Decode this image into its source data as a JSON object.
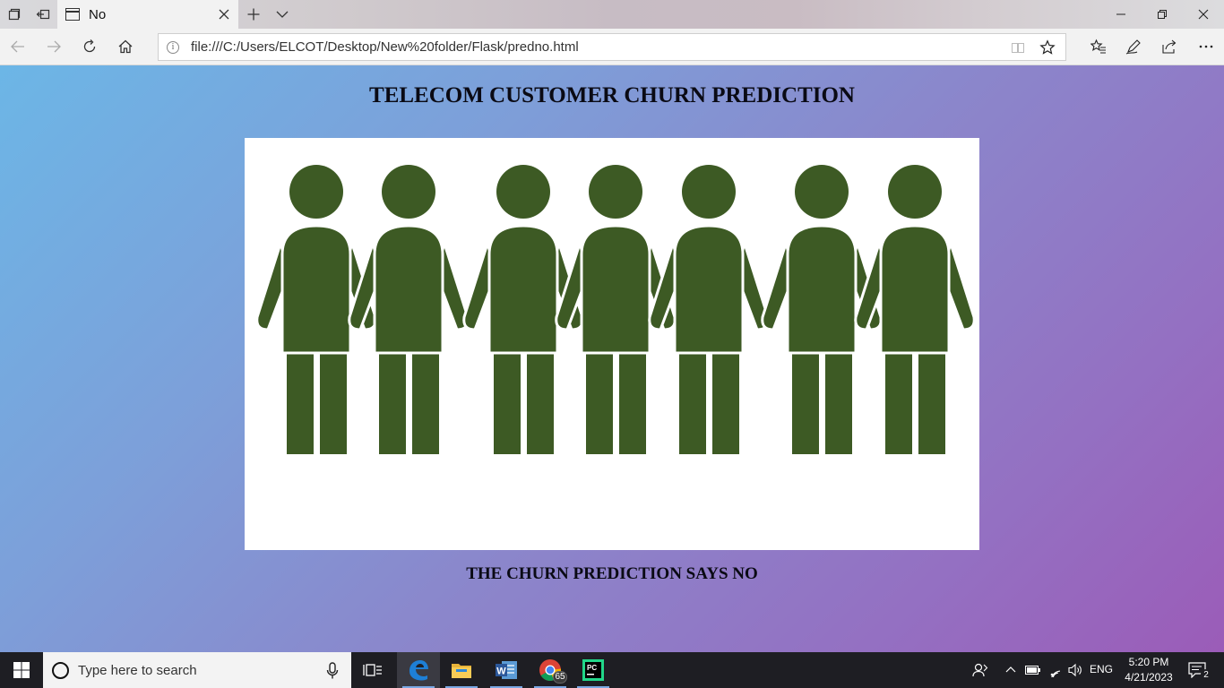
{
  "browser": {
    "tab_title": "No",
    "url": "file:///C:/Users/ELCOT/Desktop/New%20folder/Flask/predno.html"
  },
  "page": {
    "heading": "TELECOM CUSTOMER CHURN PREDICTION",
    "result": "THE CHURN PREDICTION SAYS NO",
    "figure_color": "#3d5a24",
    "figure_count": 7
  },
  "taskbar": {
    "search_placeholder": "Type here to search",
    "chrome_badge": "65",
    "language": "ENG",
    "time": "5:20 PM",
    "date": "4/21/2023",
    "notification_count": "2",
    "apps": [
      "task-view",
      "edge",
      "file-explorer",
      "word",
      "chrome",
      "pycharm"
    ]
  }
}
